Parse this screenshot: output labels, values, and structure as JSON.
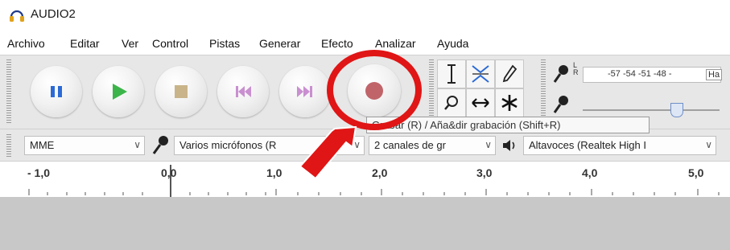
{
  "window": {
    "title": "AUDIO2"
  },
  "menu": [
    "Archivo",
    "Editar",
    "Ver",
    "Control",
    "Pistas",
    "Generar",
    "Efecto",
    "Analizar",
    "Ayuda"
  ],
  "transport": [
    {
      "name": "pause",
      "icon": "pause-icon",
      "color": "#2b6ad6"
    },
    {
      "name": "play",
      "icon": "play-icon",
      "color": "#3bb54a"
    },
    {
      "name": "stop",
      "icon": "stop-icon",
      "color": "#c9b48a"
    },
    {
      "name": "skip-start",
      "icon": "skip-to-start-icon",
      "color": "#c98fd0"
    },
    {
      "name": "skip-end",
      "icon": "skip-to-end-icon",
      "color": "#c98fd0"
    },
    {
      "name": "record",
      "icon": "record-icon",
      "color": "#c0646a"
    }
  ],
  "annotation": {
    "circle_color": "#e01515",
    "arrow_color": "#e01515"
  },
  "meter": {
    "lr_label": "L\nR",
    "scale": "-57 -54 -51 -48 -",
    "hint": "Ha"
  },
  "tooltip": "Grabar (R) / Aña&dir grabación (Shift+R)",
  "devices": {
    "host": "MME",
    "input": "Varios micrófonos (R",
    "channels": "2 canales de gr",
    "output": "Altavoces (Realtek High I"
  },
  "ruler": [
    "- 1,0",
    "0,0",
    "1,0",
    "2,0",
    "3,0",
    "4,0",
    "5,0"
  ]
}
